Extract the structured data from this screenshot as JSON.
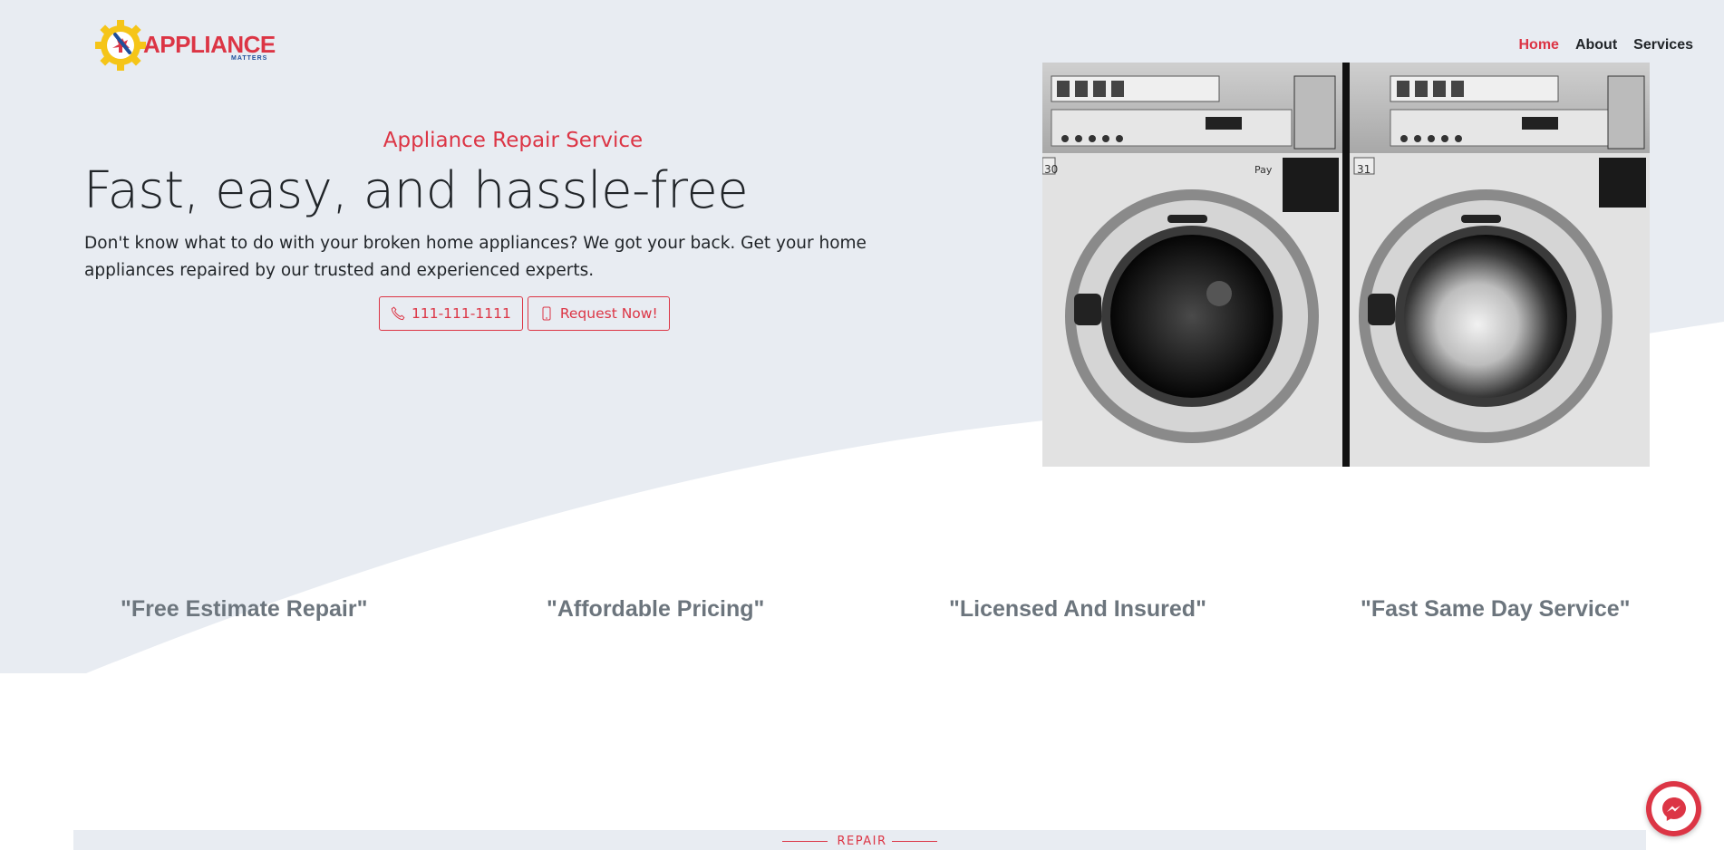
{
  "brand": {
    "name": "APPLIANCE",
    "tagline": "MATTERS",
    "accent_color": "#dc3545",
    "gear_color": "#f5c518"
  },
  "nav": {
    "items": [
      {
        "label": "Home",
        "active": true
      },
      {
        "label": "About",
        "active": false
      },
      {
        "label": "Services",
        "active": false
      }
    ]
  },
  "hero": {
    "kicker": "Appliance Repair Service",
    "headline": "Fast, easy, and hassle-free",
    "lede": "Don't know what to do with your broken home appliances? We got your back. Get your home appliances repaired by our trusted and experienced experts.",
    "phone_button": {
      "label": "111-111-1111",
      "icon": "phone-icon"
    },
    "request_button": {
      "label": "Request Now!",
      "icon": "mobile-icon"
    },
    "background_color": "#e8ecf2"
  },
  "photo": {
    "machine_numbers": [
      "30",
      "31"
    ],
    "pay_label": "Pay"
  },
  "features": [
    "\"Free Estimate Repair\"",
    "\"Affordable Pricing\"",
    "\"Licensed And Insured\"",
    "\"Fast Same Day Service\""
  ],
  "section": {
    "label": "REPAIR"
  },
  "chat": {
    "icon": "messenger-icon"
  }
}
